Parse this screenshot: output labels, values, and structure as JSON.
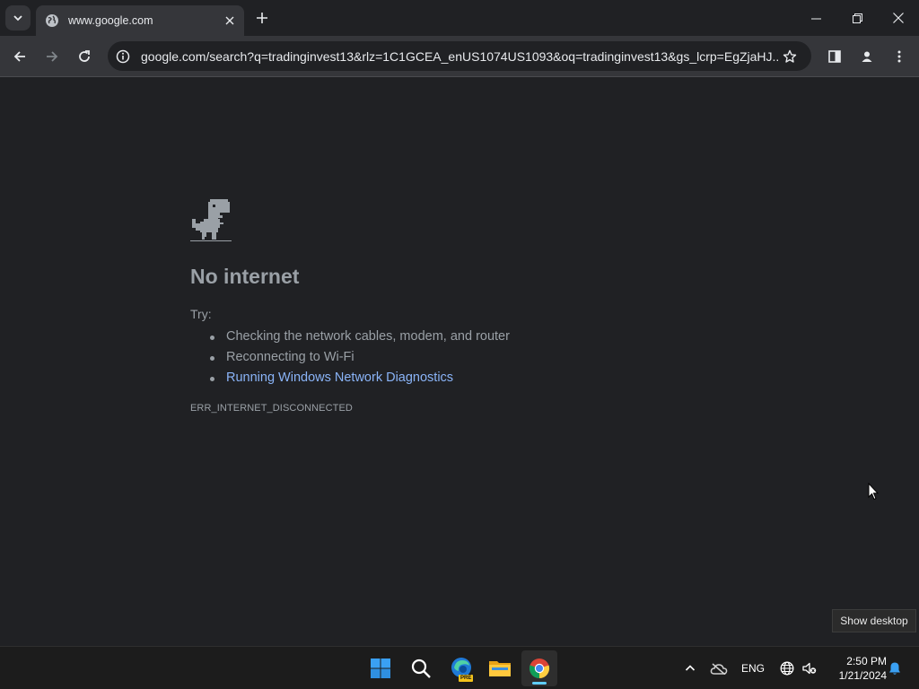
{
  "tab": {
    "title": "www.google.com"
  },
  "toolbar": {
    "url": "google.com/search?q=tradinginvest13&rlz=1C1GCEA_enUS1074US1093&oq=tradinginvest13&gs_lcrp=EgZjaHJ..."
  },
  "error": {
    "title": "No internet",
    "try_label": "Try:",
    "suggestions": [
      "Checking the network cables, modem, and router",
      "Reconnecting to Wi-Fi",
      "Running Windows Network Diagnostics"
    ],
    "code": "ERR_INTERNET_DISCONNECTED"
  },
  "tooltip": {
    "text": "Show desktop"
  },
  "taskbar": {
    "edge_badge": "PRE",
    "language": "ENG",
    "time": "2:50 PM",
    "date": "1/21/2024"
  },
  "colors": {
    "background": "#202124",
    "toolbar": "#35363a",
    "link": "#8ab4f8",
    "text": "#9aa0a6"
  },
  "icons": [
    "tab-search-icon",
    "globe-icon",
    "close-icon",
    "plus-icon",
    "minimize-icon",
    "restore-icon",
    "back-icon",
    "forward-icon",
    "reload-icon",
    "info-icon",
    "star-icon",
    "side-panel-icon",
    "profile-icon",
    "menu-icon",
    "dino-icon",
    "windows-start-icon",
    "search-icon",
    "edge-icon",
    "folder-icon",
    "chrome-icon",
    "chevron-up-icon",
    "cloud-off-icon",
    "network-icon",
    "volume-mute-icon",
    "bell-icon"
  ]
}
